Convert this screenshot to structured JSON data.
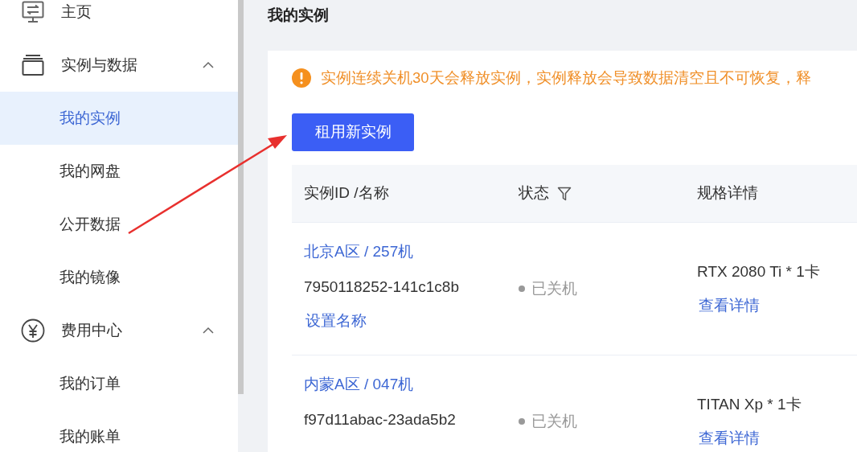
{
  "sidebar": {
    "items": [
      {
        "label": "主页"
      },
      {
        "label": "实例与数据",
        "expanded": true,
        "children": [
          {
            "label": "我的实例",
            "selected": true
          },
          {
            "label": "我的网盘",
            "selected": false
          },
          {
            "label": "公开数据",
            "selected": false
          },
          {
            "label": "我的镜像",
            "selected": false
          }
        ]
      },
      {
        "label": "费用中心",
        "expanded": true,
        "children": [
          {
            "label": "我的订单",
            "selected": false
          },
          {
            "label": "我的账单",
            "selected": false
          }
        ]
      }
    ]
  },
  "page_title": "我的实例",
  "notice": "实例连续关机30天会释放实例，实例释放会导致数据清空且不可恢复，释",
  "new_button": "租用新实例",
  "table": {
    "columns": [
      {
        "label": "实例ID /名称",
        "filter": false
      },
      {
        "label": "状态",
        "filter": true
      },
      {
        "label": "规格详情",
        "filter": false
      }
    ],
    "rows": [
      {
        "region": "北京A区 / 257机",
        "id": "7950118252-141c1c8b",
        "rename": "设置名称",
        "status": "已关机",
        "spec": "RTX 2080 Ti * 1卡",
        "details": "查看详情"
      },
      {
        "region": "内蒙A区 / 047机",
        "id": "f97d11abac-23ada5b2",
        "status": "已关机",
        "spec": "TITAN Xp * 1卡",
        "details": "查看详情"
      }
    ]
  }
}
